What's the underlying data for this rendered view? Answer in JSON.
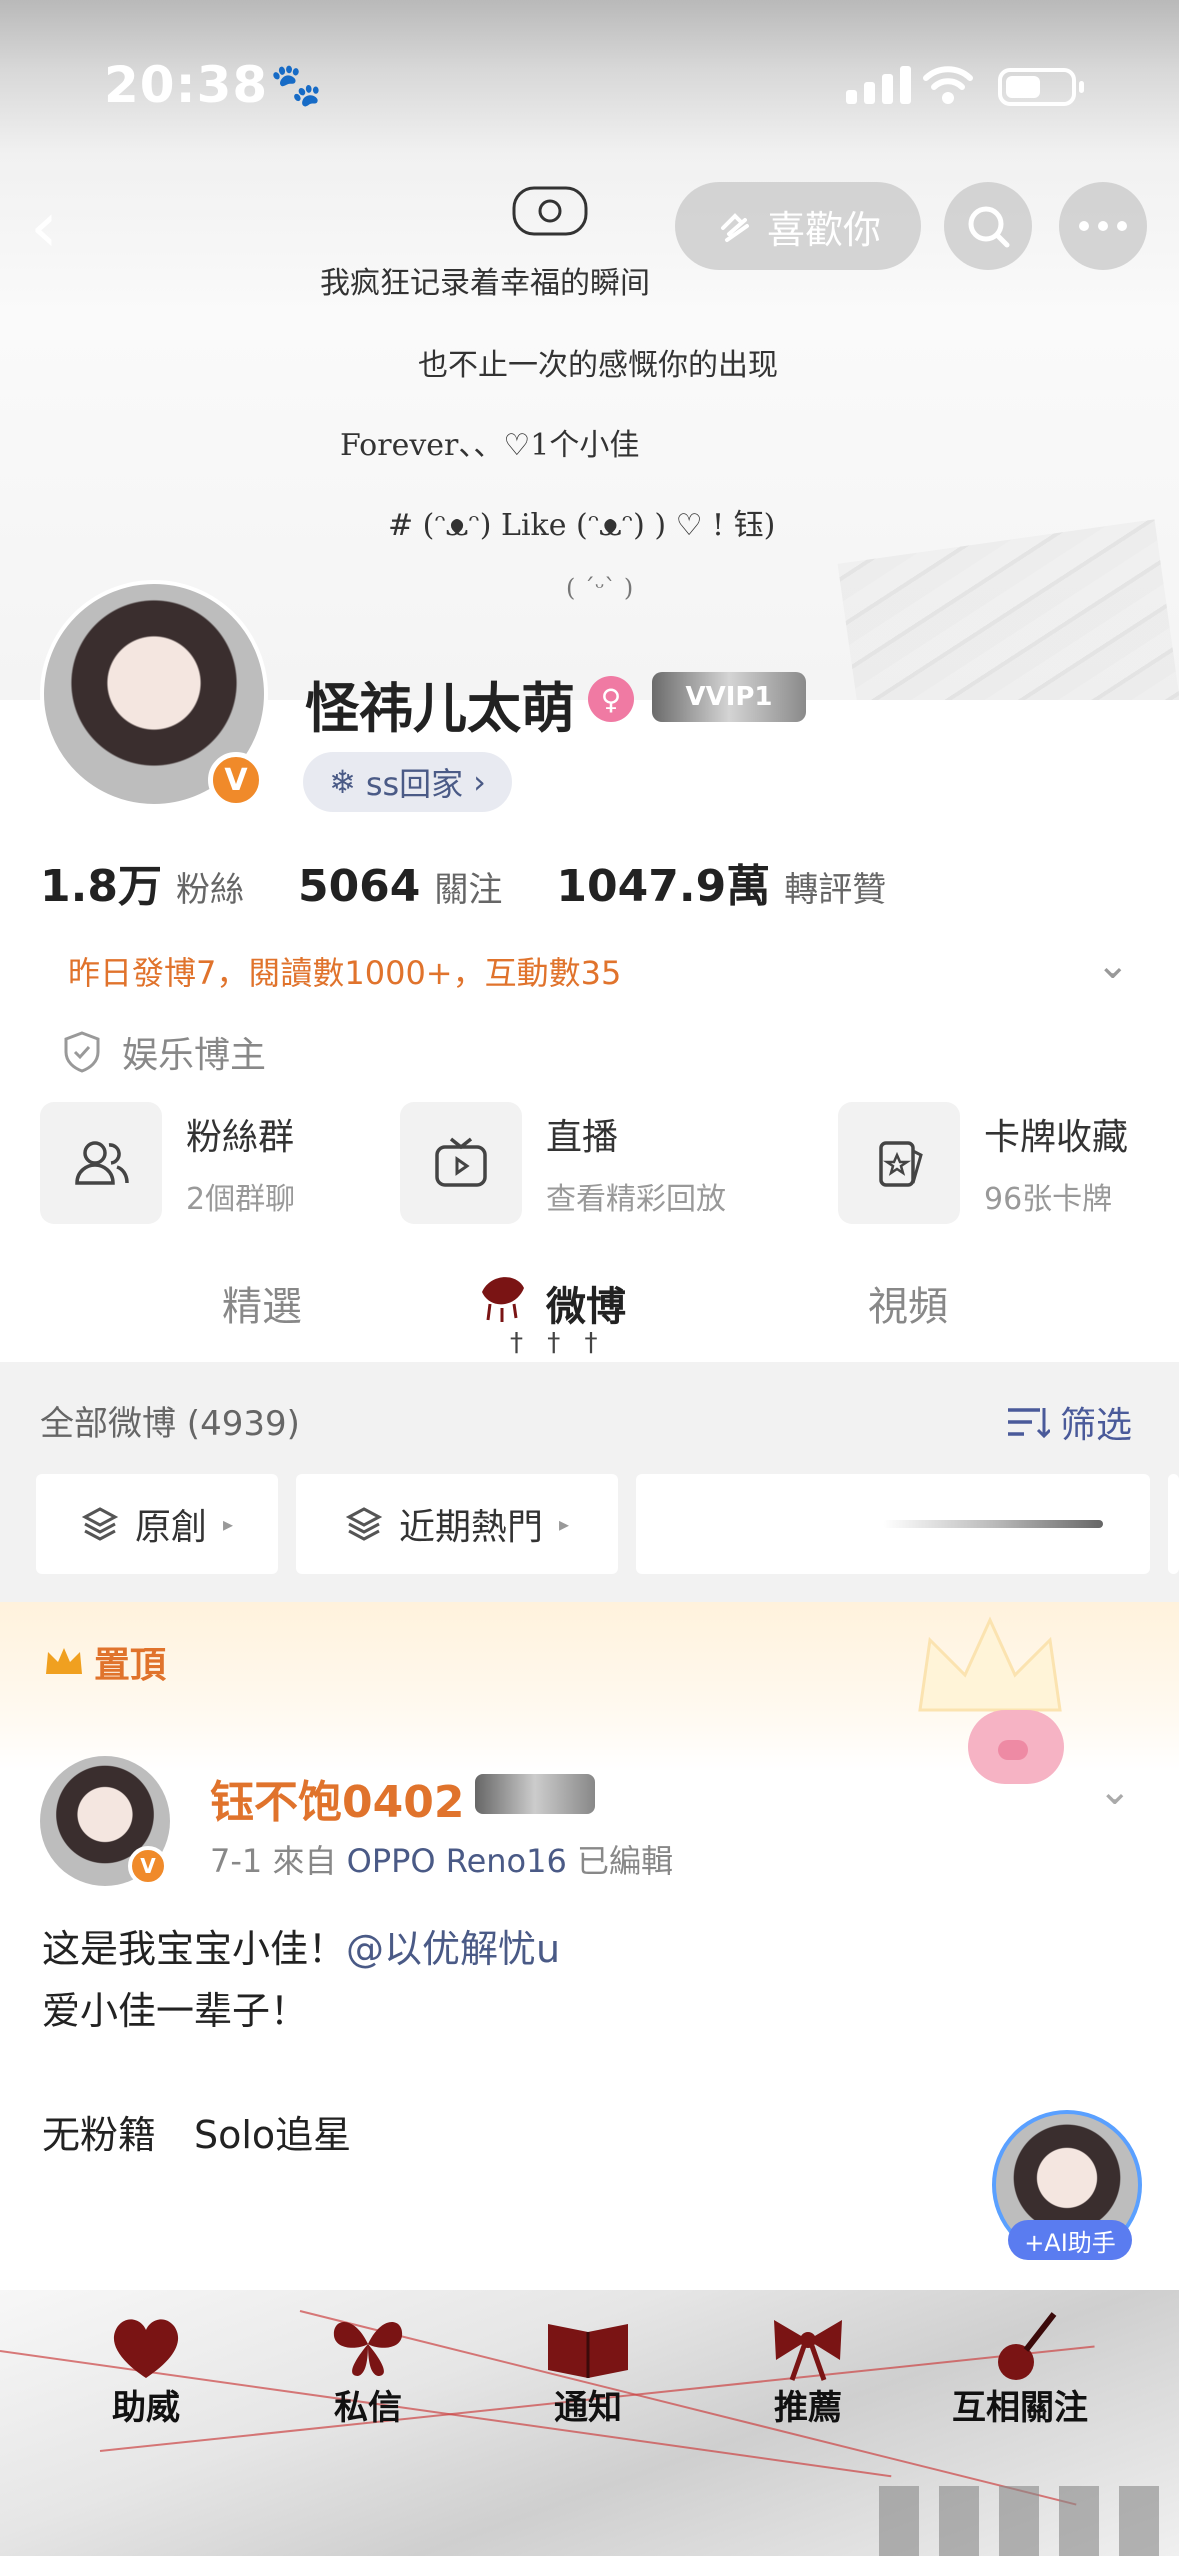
{
  "status": {
    "time": "20:38"
  },
  "header": {
    "back": "‹",
    "follow_btn": "喜歡你"
  },
  "banner_text": {
    "line1": "我疯狂记录着幸福的瞬间",
    "line2": "也不止一次的感慨你的出现",
    "line3": "Forever、、♡1个小佳",
    "line4": "# (ᵔᴥᵔ) Like (ᵔᴥᵔ) ) ♡ ! 钰)",
    "line5": "( ˊᵕˋ )"
  },
  "profile": {
    "nickname": "怪祎儿太萌",
    "gender_icon": "♀",
    "vvip": "VVIP1",
    "verified": "V",
    "fan_chip": "ss回家",
    "stats": [
      {
        "value": "1.8万",
        "label": "粉絲"
      },
      {
        "value": "5064",
        "label": "關注"
      },
      {
        "value": "1047.9萬",
        "label": "轉評贊"
      }
    ],
    "notice": "昨日發博7，閱讀數1000+，互動數35",
    "role": "娱乐博主"
  },
  "tiles": [
    {
      "title": "粉絲群",
      "sub": "2個群聊"
    },
    {
      "title": "直播",
      "sub": "查看精彩回放"
    },
    {
      "title": "卡牌收藏",
      "sub": "96张卡牌"
    }
  ],
  "tabs": {
    "featured": "精選",
    "weibo": "微博",
    "video": "視頻",
    "marks": "† † †"
  },
  "feed": {
    "all_label": "全部微博 (4939)",
    "filter": "筛选",
    "chips": [
      "原創",
      "近期熱門"
    ]
  },
  "pinned": {
    "label": "置頂",
    "author": "钰不饱0402",
    "date": "7-1",
    "from": "來自",
    "device": "OPPO Reno16",
    "edited": "已編輯",
    "body_line1_pre": "这是我宝宝小佳！",
    "mention": "@以优解忧u",
    "body_line2": "爱小佳一辈子！",
    "body_line3": "无粉籍　Solo追星"
  },
  "ai_assistant": "+AI助手",
  "bottom_nav": [
    "助威",
    "私信",
    "通知",
    "推薦",
    "互相關注"
  ],
  "colors": {
    "accent_orange": "#e0732c",
    "link_blue": "#4a5a86",
    "verified": "#f08a2a"
  }
}
